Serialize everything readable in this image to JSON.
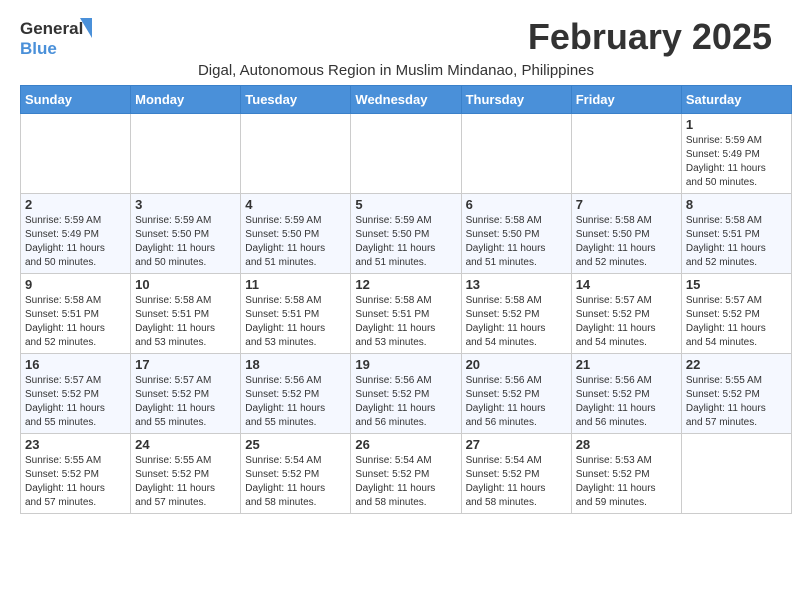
{
  "header": {
    "logo_general": "General",
    "logo_blue": "Blue",
    "month_title": "February 2025",
    "location": "Digal, Autonomous Region in Muslim Mindanao, Philippines"
  },
  "weekdays": [
    "Sunday",
    "Monday",
    "Tuesday",
    "Wednesday",
    "Thursday",
    "Friday",
    "Saturday"
  ],
  "weeks": [
    [
      {
        "day": "",
        "info": ""
      },
      {
        "day": "",
        "info": ""
      },
      {
        "day": "",
        "info": ""
      },
      {
        "day": "",
        "info": ""
      },
      {
        "day": "",
        "info": ""
      },
      {
        "day": "",
        "info": ""
      },
      {
        "day": "1",
        "info": "Sunrise: 5:59 AM\nSunset: 5:49 PM\nDaylight: 11 hours\nand 50 minutes."
      }
    ],
    [
      {
        "day": "2",
        "info": "Sunrise: 5:59 AM\nSunset: 5:49 PM\nDaylight: 11 hours\nand 50 minutes."
      },
      {
        "day": "3",
        "info": "Sunrise: 5:59 AM\nSunset: 5:50 PM\nDaylight: 11 hours\nand 50 minutes."
      },
      {
        "day": "4",
        "info": "Sunrise: 5:59 AM\nSunset: 5:50 PM\nDaylight: 11 hours\nand 51 minutes."
      },
      {
        "day": "5",
        "info": "Sunrise: 5:59 AM\nSunset: 5:50 PM\nDaylight: 11 hours\nand 51 minutes."
      },
      {
        "day": "6",
        "info": "Sunrise: 5:58 AM\nSunset: 5:50 PM\nDaylight: 11 hours\nand 51 minutes."
      },
      {
        "day": "7",
        "info": "Sunrise: 5:58 AM\nSunset: 5:50 PM\nDaylight: 11 hours\nand 52 minutes."
      },
      {
        "day": "8",
        "info": "Sunrise: 5:58 AM\nSunset: 5:51 PM\nDaylight: 11 hours\nand 52 minutes."
      }
    ],
    [
      {
        "day": "9",
        "info": "Sunrise: 5:58 AM\nSunset: 5:51 PM\nDaylight: 11 hours\nand 52 minutes."
      },
      {
        "day": "10",
        "info": "Sunrise: 5:58 AM\nSunset: 5:51 PM\nDaylight: 11 hours\nand 53 minutes."
      },
      {
        "day": "11",
        "info": "Sunrise: 5:58 AM\nSunset: 5:51 PM\nDaylight: 11 hours\nand 53 minutes."
      },
      {
        "day": "12",
        "info": "Sunrise: 5:58 AM\nSunset: 5:51 PM\nDaylight: 11 hours\nand 53 minutes."
      },
      {
        "day": "13",
        "info": "Sunrise: 5:58 AM\nSunset: 5:52 PM\nDaylight: 11 hours\nand 54 minutes."
      },
      {
        "day": "14",
        "info": "Sunrise: 5:57 AM\nSunset: 5:52 PM\nDaylight: 11 hours\nand 54 minutes."
      },
      {
        "day": "15",
        "info": "Sunrise: 5:57 AM\nSunset: 5:52 PM\nDaylight: 11 hours\nand 54 minutes."
      }
    ],
    [
      {
        "day": "16",
        "info": "Sunrise: 5:57 AM\nSunset: 5:52 PM\nDaylight: 11 hours\nand 55 minutes."
      },
      {
        "day": "17",
        "info": "Sunrise: 5:57 AM\nSunset: 5:52 PM\nDaylight: 11 hours\nand 55 minutes."
      },
      {
        "day": "18",
        "info": "Sunrise: 5:56 AM\nSunset: 5:52 PM\nDaylight: 11 hours\nand 55 minutes."
      },
      {
        "day": "19",
        "info": "Sunrise: 5:56 AM\nSunset: 5:52 PM\nDaylight: 11 hours\nand 56 minutes."
      },
      {
        "day": "20",
        "info": "Sunrise: 5:56 AM\nSunset: 5:52 PM\nDaylight: 11 hours\nand 56 minutes."
      },
      {
        "day": "21",
        "info": "Sunrise: 5:56 AM\nSunset: 5:52 PM\nDaylight: 11 hours\nand 56 minutes."
      },
      {
        "day": "22",
        "info": "Sunrise: 5:55 AM\nSunset: 5:52 PM\nDaylight: 11 hours\nand 57 minutes."
      }
    ],
    [
      {
        "day": "23",
        "info": "Sunrise: 5:55 AM\nSunset: 5:52 PM\nDaylight: 11 hours\nand 57 minutes."
      },
      {
        "day": "24",
        "info": "Sunrise: 5:55 AM\nSunset: 5:52 PM\nDaylight: 11 hours\nand 57 minutes."
      },
      {
        "day": "25",
        "info": "Sunrise: 5:54 AM\nSunset: 5:52 PM\nDaylight: 11 hours\nand 58 minutes."
      },
      {
        "day": "26",
        "info": "Sunrise: 5:54 AM\nSunset: 5:52 PM\nDaylight: 11 hours\nand 58 minutes."
      },
      {
        "day": "27",
        "info": "Sunrise: 5:54 AM\nSunset: 5:52 PM\nDaylight: 11 hours\nand 58 minutes."
      },
      {
        "day": "28",
        "info": "Sunrise: 5:53 AM\nSunset: 5:52 PM\nDaylight: 11 hours\nand 59 minutes."
      },
      {
        "day": "",
        "info": ""
      }
    ]
  ]
}
